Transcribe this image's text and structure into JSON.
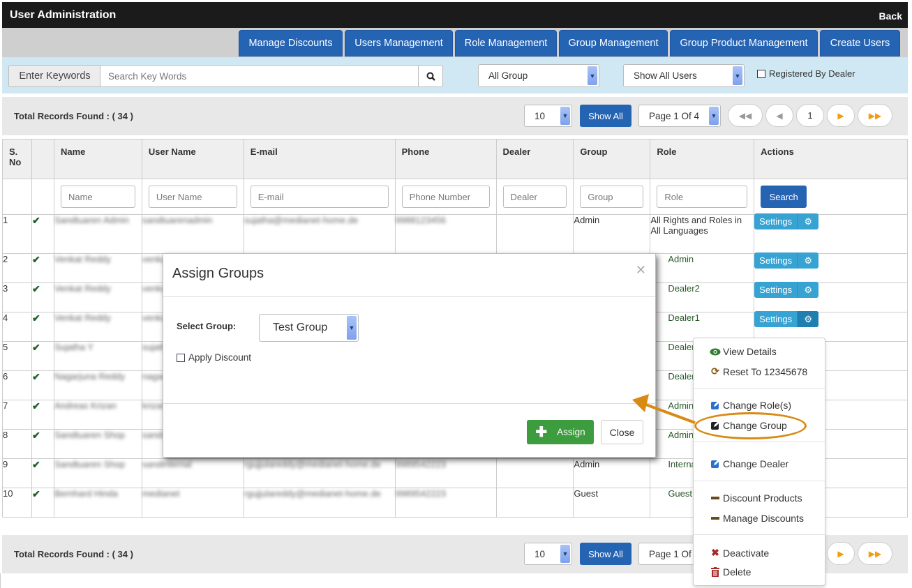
{
  "header": {
    "title": "User Administration",
    "back_label": "Back"
  },
  "nav": {
    "buttons": [
      {
        "label": "Manage Discounts"
      },
      {
        "label": "Users Management"
      },
      {
        "label": "Role Management"
      },
      {
        "label": "Group Management"
      },
      {
        "label": "Group Product Management"
      },
      {
        "label": "Create Users"
      }
    ]
  },
  "search": {
    "label": "Enter Keywords",
    "placeholder": "Search Key Words",
    "value": "",
    "group_filter": "All Group",
    "user_filter": "Show All Users",
    "registered_by_dealer_label": "Registered By Dealer",
    "registered_by_dealer_checked": false
  },
  "pager_top": {
    "total_label": "Total Records Found : ( 34 )",
    "page_size": "10",
    "show_all_label": "Show All",
    "page_select": "Page 1 Of 4",
    "current_page": "1",
    "first_icon": "first-page-icon",
    "prev_icon": "prev-page-icon",
    "next_icon": "next-page-icon",
    "last_icon": "last-page-icon"
  },
  "pager_bottom": {
    "total_label": "Total Records Found : ( 34 )",
    "page_size": "10",
    "show_all_label": "Show All",
    "page_select": "Page 1 Of 4"
  },
  "table": {
    "columns": [
      "S. No",
      "",
      "Name",
      "User Name",
      "E-mail",
      "Phone",
      "Dealer",
      "Group",
      "Role",
      "Actions"
    ],
    "filters": {
      "name": "Name",
      "username": "User Name",
      "email": "E-mail",
      "phone": "Phone Number",
      "dealer": "Dealer",
      "group": "Group",
      "role": "Role",
      "search_label": "Search"
    },
    "settings_label": "Settings",
    "rows": [
      {
        "sno": "1",
        "active": true,
        "name": "Sandtuaren Admin",
        "username": "sandtuarenadmin",
        "email": "sujatha@medianet-home.de",
        "phone": "9988123456",
        "dealer": "",
        "group": "Admin",
        "role": "All Rights and Roles in All Languages"
      },
      {
        "sno": "2",
        "active": true,
        "name": "Venkat Reddy",
        "username": "venkat",
        "email": "",
        "phone": "",
        "dealer": "",
        "group": "",
        "role": "Admin"
      },
      {
        "sno": "3",
        "active": true,
        "name": "Venkat Reddy",
        "username": "venkat",
        "email": "",
        "phone": "",
        "dealer": "",
        "group": "",
        "role": "Dealer2"
      },
      {
        "sno": "4",
        "active": true,
        "name": "Venkat Reddy",
        "username": "venkat",
        "email": "",
        "phone": "",
        "dealer": "",
        "group": "",
        "role": "Dealer1"
      },
      {
        "sno": "5",
        "active": true,
        "name": "Sujatha Y",
        "username": "sujatha",
        "email": "",
        "phone": "",
        "dealer": "",
        "group": "",
        "role": "Dealer"
      },
      {
        "sno": "6",
        "active": true,
        "name": "Nagarjuna Reddy",
        "username": "nagarjuna",
        "email": "",
        "phone": "",
        "dealer": "",
        "group": "",
        "role": "Dealer"
      },
      {
        "sno": "7",
        "active": true,
        "name": "Andreas Krizan",
        "username": "krizan",
        "email": "",
        "phone": "",
        "dealer": "",
        "group": "",
        "role": "Admin"
      },
      {
        "sno": "8",
        "active": true,
        "name": "Sandtuaren Shop",
        "username": "sandshop",
        "email": "",
        "phone": "",
        "dealer": "",
        "group": "",
        "role": "Admin"
      },
      {
        "sno": "9",
        "active": true,
        "name": "Sandtuaren Shop",
        "username": "sandinternal",
        "email": "rgujjulareddy@medianet-home.de",
        "phone": "9989542223",
        "dealer": "",
        "group": "Admin",
        "role": "Internal"
      },
      {
        "sno": "10",
        "active": true,
        "name": "Bernhard Hinda",
        "username": "medianet",
        "email": "rgujjulareddy@medianet-home.de",
        "phone": "9989542223",
        "dealer": "",
        "group": "Guest",
        "role": "Guest"
      }
    ]
  },
  "modal": {
    "title": "Assign Groups",
    "select_group_label": "Select Group:",
    "selected_group": "Test Group",
    "apply_discount_label": "Apply Discount",
    "apply_discount_checked": false,
    "assign_label": "Assign",
    "close_label": "Close"
  },
  "actions_menu": {
    "items": [
      {
        "label": "View Details",
        "icon": "eye-icon"
      },
      {
        "label": "Reset To 12345678",
        "icon": "refresh-icon"
      },
      {
        "label": "Change Role(s)",
        "icon": "edit-icon"
      },
      {
        "label": "Change Group",
        "icon": "edit-icon",
        "highlighted": true
      },
      {
        "label": "Change Dealer",
        "icon": "edit-icon"
      },
      {
        "label": "Discount Products",
        "icon": "minus-icon"
      },
      {
        "label": "Manage Discounts",
        "icon": "minus-icon"
      },
      {
        "label": "Deactivate",
        "icon": "x-icon"
      },
      {
        "label": "Delete",
        "icon": "trash-icon"
      }
    ]
  },
  "colors": {
    "primary": "#2563b3",
    "settings": "#36a3d3",
    "success": "#3d9c3d",
    "annotation": "#d88a12",
    "pager_arrow_active": "#f39c12"
  }
}
